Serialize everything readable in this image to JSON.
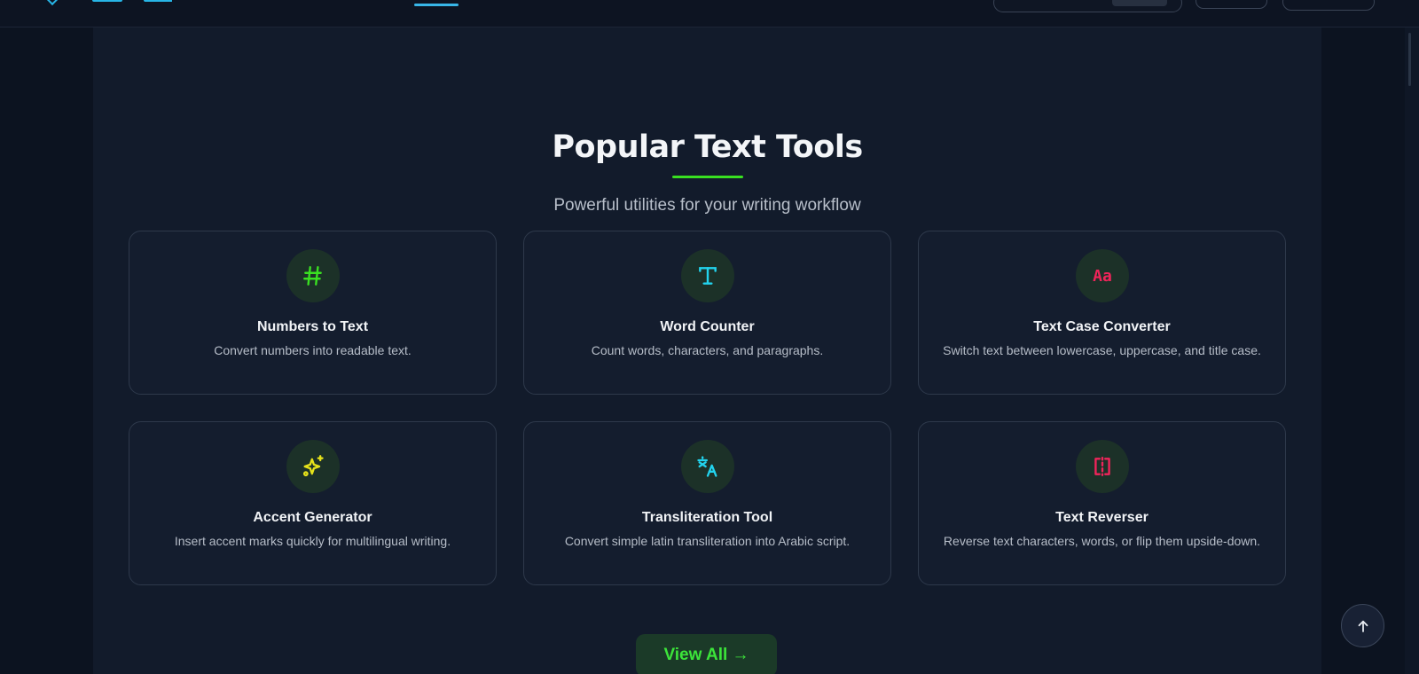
{
  "section": {
    "title": "Popular Text Tools",
    "subtitle": "Powerful utilities for your writing workflow"
  },
  "tools": [
    {
      "title": "Numbers to Text",
      "description": "Convert numbers into readable text.",
      "icon": "hash-icon",
      "icon_color": "#39e021"
    },
    {
      "title": "Word Counter",
      "description": "Count words, characters, and paragraphs.",
      "icon": "text-t-icon",
      "icon_color": "#22d3ee"
    },
    {
      "title": "Text Case Converter",
      "description": "Switch text between lowercase, uppercase, and title case.",
      "icon": "aa-icon",
      "icon_color": "#f0245a",
      "icon_text": "Aa"
    },
    {
      "title": "Accent Generator",
      "description": "Insert accent marks quickly for multilingual writing.",
      "icon": "sparkles-icon",
      "icon_color": "#e6e21a"
    },
    {
      "title": "Transliteration Tool",
      "description": "Convert simple latin transliteration into Arabic script.",
      "icon": "translate-icon",
      "icon_color": "#22d3ee"
    },
    {
      "title": "Text Reverser",
      "description": "Reverse text characters, words, or flip them upside-down.",
      "icon": "flip-icon",
      "icon_color": "#f0245a"
    }
  ],
  "view_all_label": "View All →",
  "colors": {
    "accent_green": "#39e021",
    "accent_cyan": "#22d3ee",
    "accent_pink": "#f0245a",
    "background": "#121b2b"
  }
}
